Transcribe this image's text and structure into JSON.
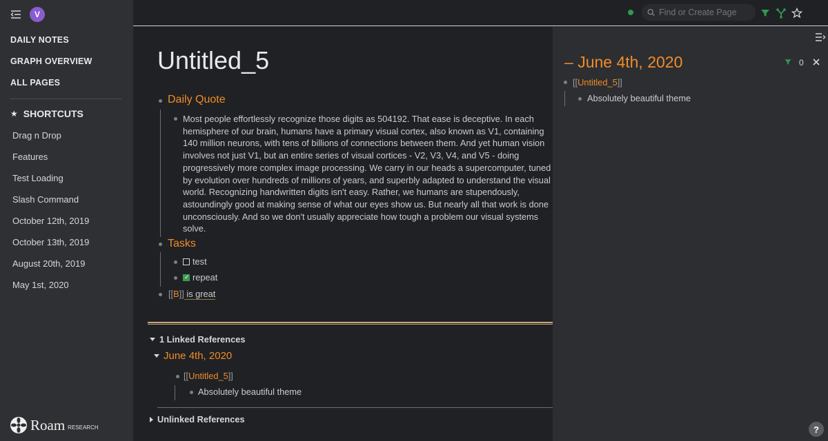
{
  "sidebar": {
    "avatar_letter": "V",
    "nav": [
      "DAILY NOTES",
      "GRAPH OVERVIEW",
      "ALL PAGES"
    ],
    "shortcuts_label": "SHORTCUTS",
    "shortcuts": [
      "Drag n Drop",
      "Features",
      "Test Loading",
      "Slash Command",
      "October 12th, 2019",
      "October 13th, 2019",
      "August 20th, 2019",
      "May 1st, 2020"
    ],
    "logo_word": "Roam",
    "logo_sub": "RESEARCH"
  },
  "topbar": {
    "search_placeholder": "Find or Create Page",
    "icons": [
      "filter-icon",
      "graph-icon",
      "star-icon"
    ]
  },
  "page": {
    "title": "Untitled_5",
    "daily_quote": "Daily Quote",
    "quote_text": "Most people effortlessly recognize those digits as 504192. That ease is deceptive. In each hemisphere of our brain, humans have a primary visual cortex, also known as V1, containing 140 million neurons, with tens of billions of connections between them. And yet human vision involves not just V1, but an entire series of visual cortices - V2, V3, V4, and V5 - doing progressively more complex image processing. We carry in our heads a supercomputer, tuned by evolution over hundreds of millions of years, and superbly adapted to understand the visual world. Recognizing handwritten digits isn't easy. Rather, we humans are stupendously, astoundingly good at making sense of what our eyes show us. But nearly all that work is done unconsciously. And so we don't usually appreciate how tough a problem our visual systems solve.",
    "tasks": "Tasks",
    "task1": "test",
    "task2": "repeat",
    "ref_open": "[[",
    "ref_link": "B",
    "ref_close": "]]",
    "ref_rest": " is great"
  },
  "references": {
    "linked_label": "1 Linked References",
    "linked_page": "June 4th, 2020",
    "link_open": "[[",
    "link_text": "Untitled_5",
    "link_close": "]]",
    "child": "Absolutely beautiful theme",
    "unlinked_label": "Unlinked References"
  },
  "right_panel": {
    "title": "June 4th, 2020",
    "collapse_glyph": "–",
    "filter_count": "0",
    "link_open": "[[",
    "link_text": "Untitled_5",
    "link_close": "]]",
    "child": "Absolutely beautiful theme"
  },
  "help_glyph": "?",
  "colors": {
    "accent": "#f08c2a",
    "sidebar": "#2f3033",
    "main": "#202124",
    "panel": "#2d2e31"
  }
}
